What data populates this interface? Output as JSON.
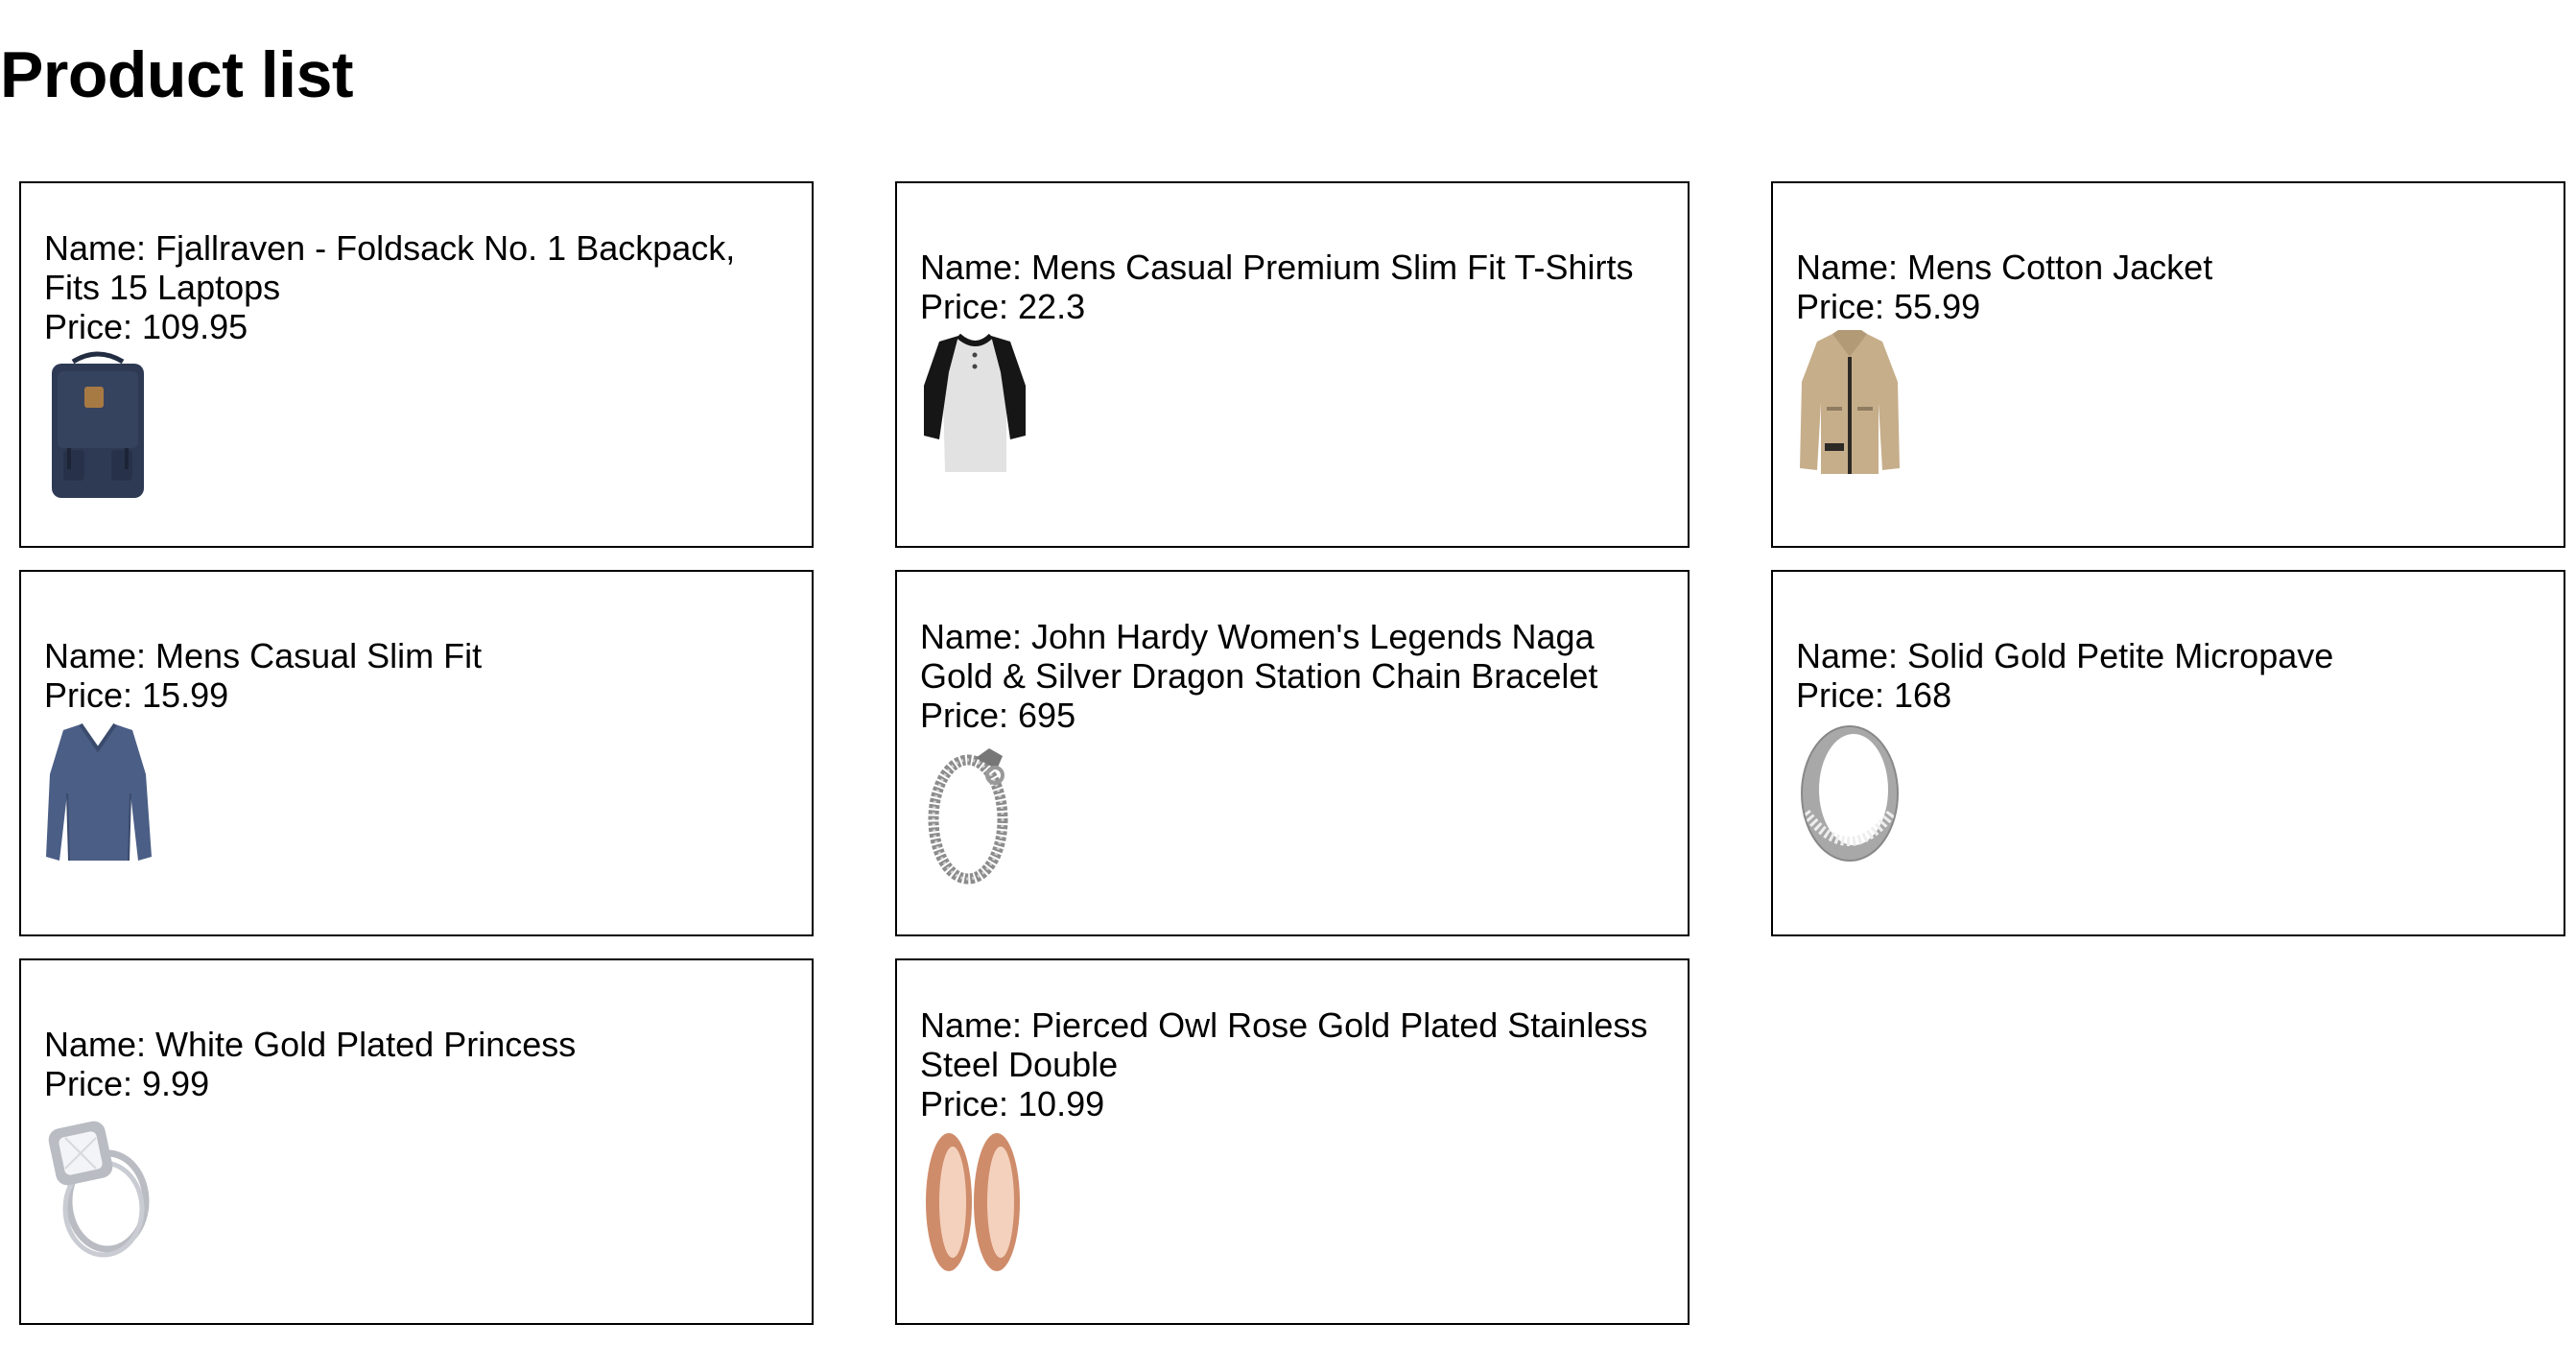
{
  "page": {
    "title": "Product list"
  },
  "labels": {
    "name_prefix": "Name: ",
    "price_prefix": "Price: "
  },
  "products": [
    {
      "name": "Fjallraven - Foldsack No. 1 Backpack, Fits 15 Laptops",
      "price": "109.95",
      "icon": "backpack-icon",
      "colors": {
        "primary": "#2e3a54",
        "accent": "#a87a43"
      }
    },
    {
      "name": "Mens Casual Premium Slim Fit T-Shirts",
      "price": "22.3",
      "icon": "raglan-tshirt-icon",
      "colors": {
        "primary": "#e2e2e2",
        "accent": "#161616"
      }
    },
    {
      "name": "Mens Cotton Jacket",
      "price": "55.99",
      "icon": "jacket-icon",
      "colors": {
        "primary": "#c6ae8b",
        "accent": "#2d2a26"
      }
    },
    {
      "name": "Mens Casual Slim Fit",
      "price": "15.99",
      "icon": "long-sleeve-shirt-icon",
      "colors": {
        "primary": "#4b5e86",
        "accent": "#3b4b6d"
      }
    },
    {
      "name": "John Hardy Women's Legends Naga Gold & Silver Dragon Station Chain Bracelet",
      "price": "695",
      "icon": "chain-bracelet-icon",
      "colors": {
        "primary": "#8c8c8c",
        "accent": "#cfcfcf"
      }
    },
    {
      "name": "Solid Gold Petite Micropave",
      "price": "168",
      "icon": "silver-band-ring-icon",
      "colors": {
        "primary": "#a8a8a8",
        "accent": "#eeeeee"
      }
    },
    {
      "name": "White Gold Plated Princess",
      "price": "9.99",
      "icon": "diamond-ring-icon",
      "colors": {
        "primary": "#b9bcc2",
        "accent": "#f2f4f7"
      }
    },
    {
      "name": "Pierced Owl Rose Gold Plated Stainless Steel Double",
      "price": "10.99",
      "icon": "rose-gold-plugs-icon",
      "colors": {
        "primary": "#cf8c6a",
        "accent": "#f4d1bd"
      }
    }
  ]
}
